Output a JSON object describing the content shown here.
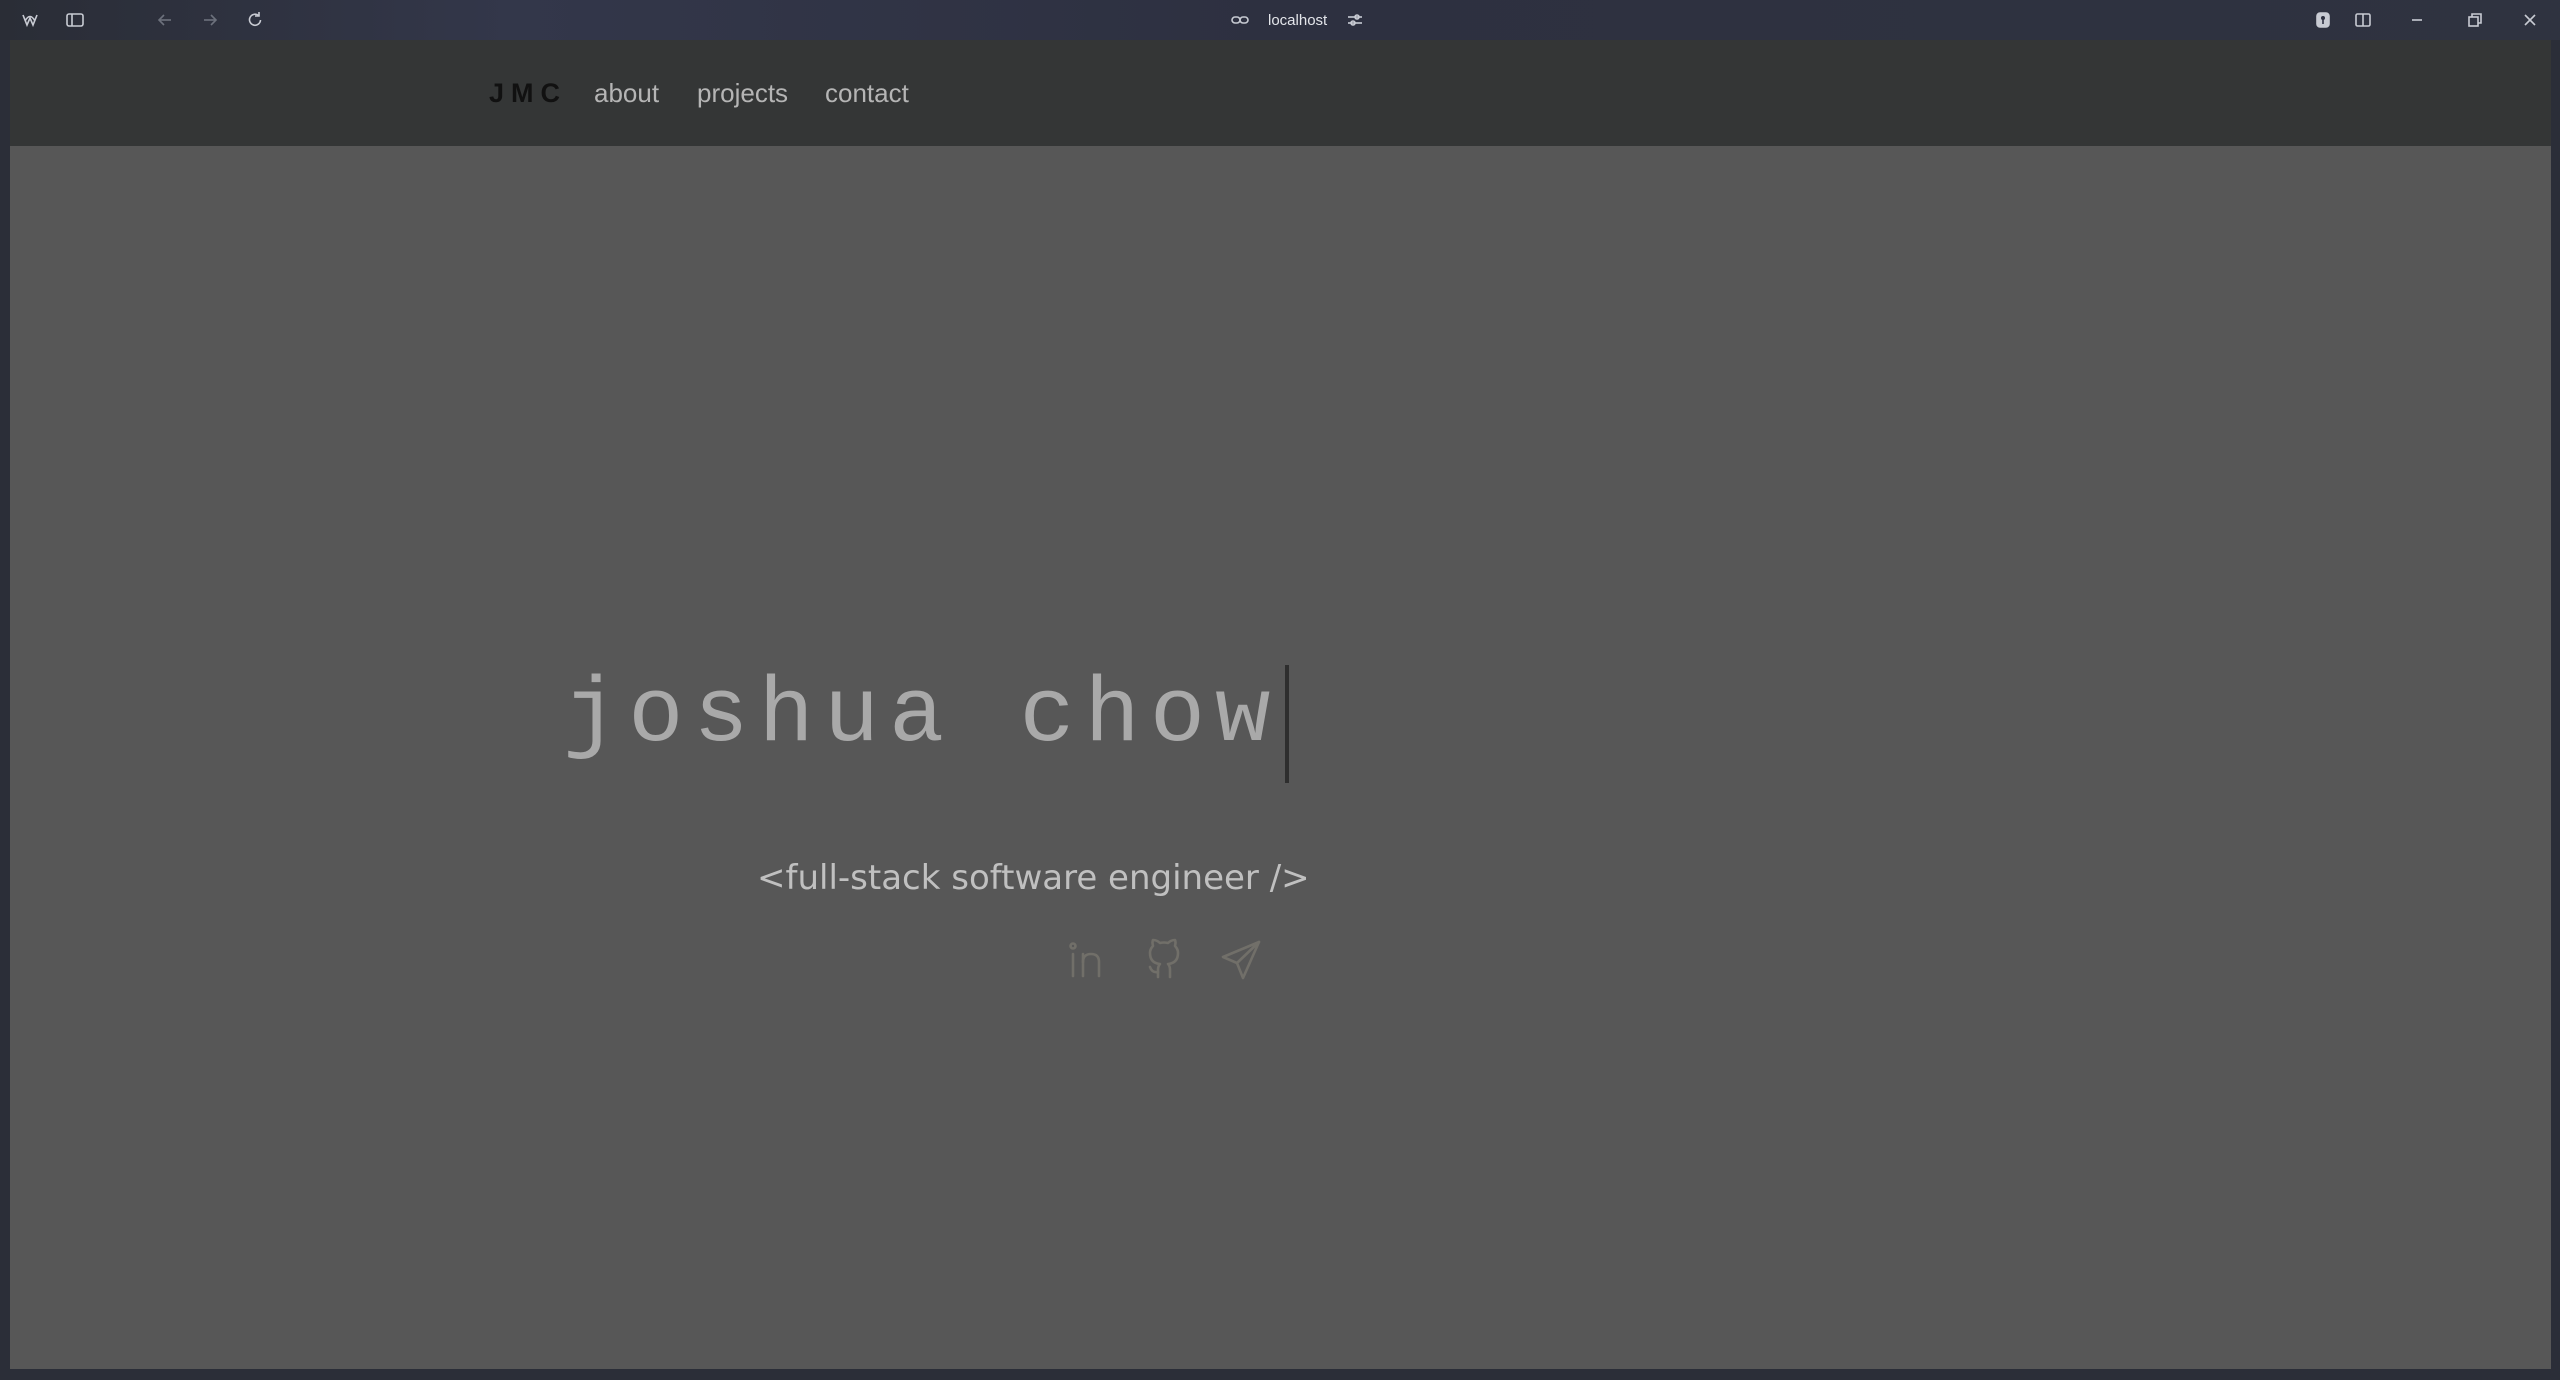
{
  "browser": {
    "url": "localhost"
  },
  "nav": {
    "logo": "JMC",
    "links": [
      "about",
      "projects",
      "contact"
    ]
  },
  "hero": {
    "name": "joshua chow",
    "subtitle": "<full-stack software engineer />"
  },
  "social_icons": [
    "linkedin-icon",
    "github-icon",
    "send-icon"
  ],
  "colors": {
    "page_background": "#575757",
    "nav_background": "#343636",
    "name_text": "#a9a9a9",
    "icon": "#716f69"
  }
}
